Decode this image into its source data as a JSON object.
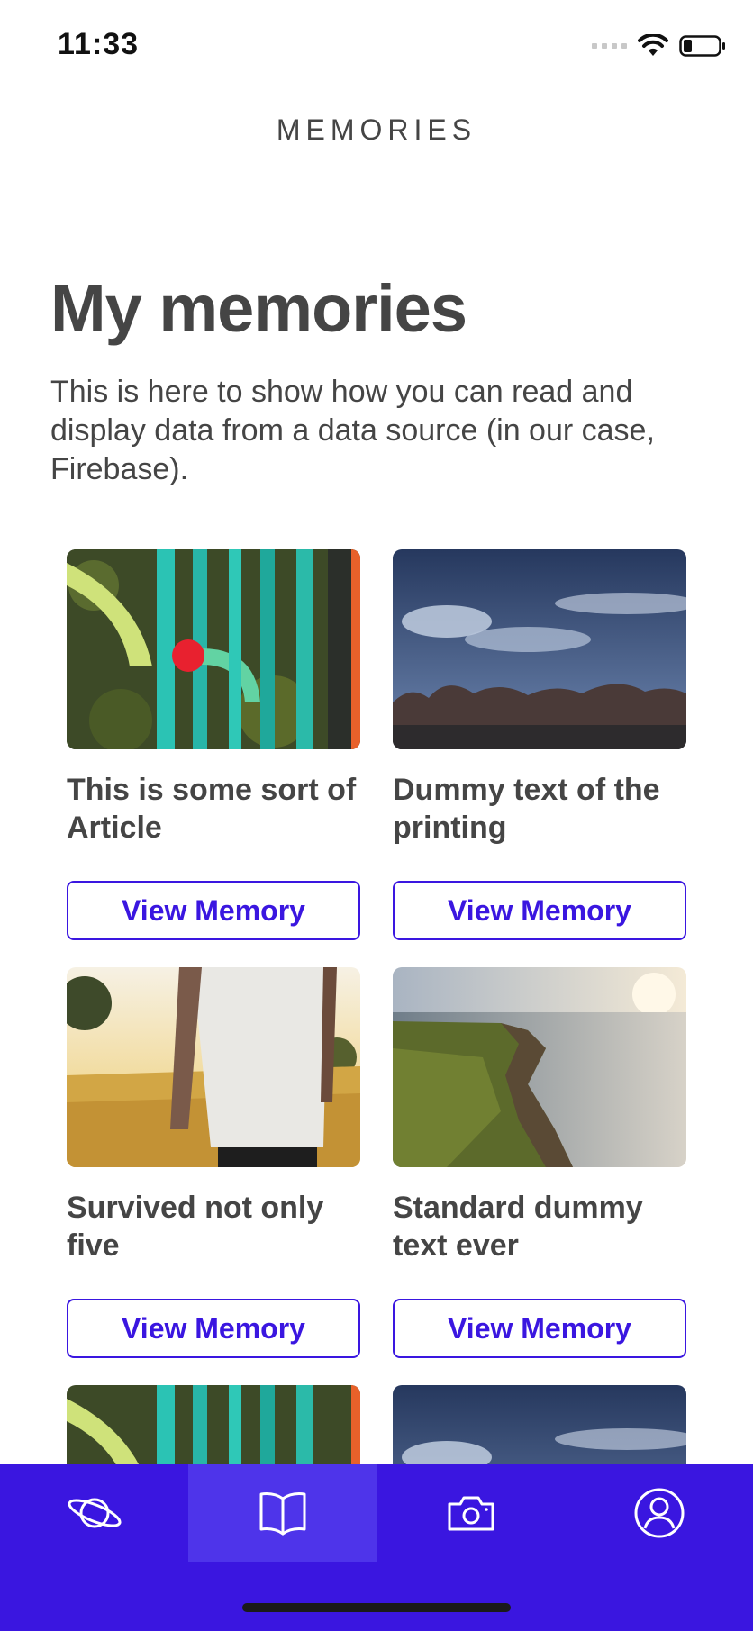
{
  "status_bar": {
    "time": "11:33"
  },
  "nav": {
    "title": "MEMORIES"
  },
  "header": {
    "title": "My memories",
    "description": "This is here to show how you can read and display data from a data source (in our case, Firebase)."
  },
  "memories": [
    {
      "title": "This is some sort of Article",
      "button_label": "View Memory",
      "image": "aerial-waterpark"
    },
    {
      "title": "Dummy text of the printing",
      "button_label": "View Memory",
      "image": "night-sky-trees"
    },
    {
      "title": "Survived not only five",
      "button_label": "View Memory",
      "image": "tattooed-person-field"
    },
    {
      "title": "Standard dummy text ever",
      "button_label": "View Memory",
      "image": "coastal-cliff-sunset"
    }
  ],
  "tab_bar": {
    "items": [
      {
        "icon": "planet-icon",
        "active": false
      },
      {
        "icon": "book-icon",
        "active": true
      },
      {
        "icon": "camera-icon",
        "active": false
      },
      {
        "icon": "user-icon",
        "active": false
      }
    ]
  },
  "colors": {
    "accent": "#3a16e0",
    "text": "#454545",
    "active_tab": "#4e34ea"
  }
}
